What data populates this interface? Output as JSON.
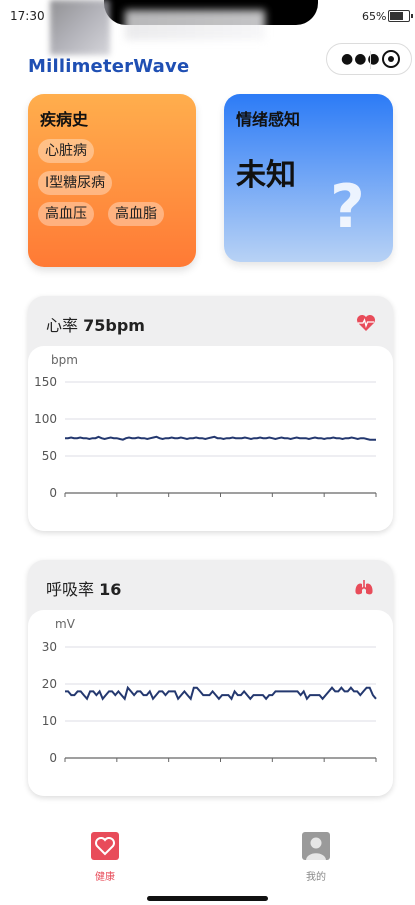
{
  "status": {
    "time": "17:30",
    "battery": "65%"
  },
  "app": {
    "title": "MillimeterWave"
  },
  "capsule": {
    "more_icon": "more-dots-icon",
    "close_icon": "target-icon"
  },
  "disease": {
    "title": "疾病史",
    "tags": [
      "心脏病",
      "I型糖尿病",
      "高血压",
      "高血脂"
    ]
  },
  "emotion": {
    "title": "情绪感知",
    "value": "未知",
    "icon": "question-mark-icon"
  },
  "heart": {
    "label": "心率",
    "value": "75bpm",
    "icon": "heart-pulse-icon",
    "accent": "#e84c5a"
  },
  "resp": {
    "label": "呼吸率",
    "value": "16",
    "icon": "lungs-icon",
    "accent": "#e84c5a"
  },
  "tabs": [
    {
      "label": "健康",
      "icon": "health-heart-icon",
      "active": true,
      "color": "#e84c5a"
    },
    {
      "label": "我的",
      "icon": "user-avatar-icon",
      "active": false,
      "color": "#888888"
    }
  ],
  "chart_data": [
    {
      "type": "line",
      "ylabel": "bpm",
      "ylim": [
        0,
        150
      ],
      "yticks": [
        0,
        50,
        100,
        150
      ],
      "grid": true,
      "series": [
        {
          "color": "#24386f",
          "values": [
            74,
            74,
            75,
            74,
            74,
            75,
            74,
            74,
            73,
            74,
            74,
            76,
            74,
            73,
            74,
            75,
            74,
            74,
            73,
            72,
            74,
            75,
            74,
            74,
            75,
            74,
            74,
            73,
            74,
            75,
            76,
            74,
            73,
            74,
            74,
            75,
            74,
            74,
            75,
            74,
            73,
            74,
            74,
            75,
            74,
            74,
            73,
            74,
            75,
            76,
            74,
            74,
            73,
            74,
            74,
            75,
            74,
            74,
            74,
            75,
            74,
            73,
            74,
            74,
            75,
            74,
            74,
            75,
            74,
            73,
            74,
            75,
            74,
            74,
            73,
            74,
            75,
            74,
            74,
            74,
            73,
            74,
            75,
            74,
            74,
            73,
            74,
            74,
            75,
            74,
            74,
            73,
            74,
            74,
            75,
            74,
            73,
            74,
            74,
            73,
            72,
            72,
            72
          ]
        }
      ]
    },
    {
      "type": "line",
      "ylabel": "mV",
      "ylim": [
        0,
        30
      ],
      "yticks": [
        0,
        10,
        20,
        30
      ],
      "grid": true,
      "series": [
        {
          "color": "#24386f",
          "values": [
            18,
            18,
            17,
            17,
            18,
            18,
            17,
            16,
            18,
            18,
            17,
            18,
            16,
            17,
            18,
            18,
            17,
            18,
            17,
            16,
            19,
            18,
            17,
            18,
            18,
            17,
            17,
            18,
            16,
            17,
            18,
            18,
            17,
            18,
            18,
            18,
            16,
            17,
            18,
            17,
            16,
            19,
            19,
            18,
            17,
            17,
            17,
            18,
            17,
            16,
            17,
            17,
            17,
            16,
            18,
            17,
            17,
            18,
            17,
            16,
            17,
            17,
            17,
            17,
            16,
            17,
            17,
            18,
            18,
            18,
            18,
            18,
            18,
            18,
            18,
            17,
            18,
            16,
            17,
            17,
            17,
            17,
            16,
            17,
            18,
            19,
            18,
            18,
            19,
            18,
            18,
            19,
            18,
            18,
            17,
            18,
            19,
            19,
            17,
            16
          ]
        }
      ]
    }
  ]
}
